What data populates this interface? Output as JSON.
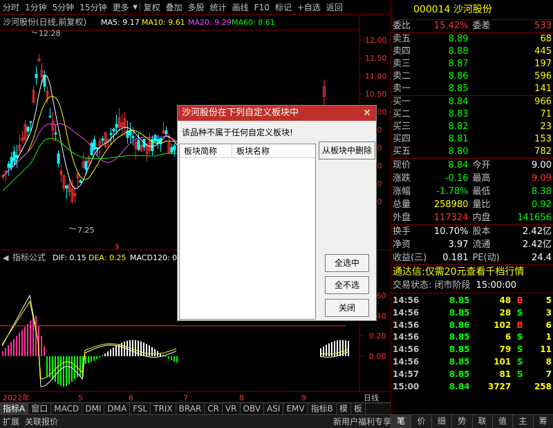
{
  "toolbar": {
    "items": [
      "分时",
      "1分钟",
      "5分钟",
      "15分钟",
      "更多",
      "复权",
      "叠加",
      "多股",
      "统计",
      "画线",
      "F10",
      "标记",
      "+自选",
      "返回"
    ]
  },
  "kline": {
    "title": "沙河股份(日线,前复权)",
    "ma5": "MA5: 9.17",
    "ma10": "MA10: 9.61",
    "ma20": "MA20: 9.29",
    "ma60": "MA60: 8.61",
    "high_label": "12.28",
    "low_label": "7.25",
    "yticks": [
      "12.00",
      "11.50",
      "11.00",
      "10.50",
      "10.00",
      "9.50",
      "9.00",
      "8.50",
      "8.00",
      "7.50"
    ],
    "dollar": "$"
  },
  "macd": {
    "label": "指标公式",
    "dif": "DIF: 0.15",
    "dea": "DEA: 0.25",
    "macd": "MACD120: 0.",
    "yticks": [
      "0.60",
      "0.40",
      "0.20",
      "0.00"
    ]
  },
  "xaxis": {
    "year": "2022年",
    "months": [
      "5",
      "6",
      "7",
      "8",
      "9"
    ],
    "period": "日线"
  },
  "bottombar": {
    "items": [
      "指标A",
      "窗口",
      "MACD",
      "DMI",
      "DMA",
      "FSL",
      "TRIX",
      "BRAR",
      "CR",
      "VR",
      "OBV",
      "ASI",
      "EMV",
      "指标B",
      "模",
      "板"
    ]
  },
  "statusbar": {
    "left1": "扩展",
    "left2": "关联报价",
    "right": "新用户福利专享"
  },
  "quote": {
    "code": "000014",
    "name": "沙河股份",
    "weibi_label": "委比",
    "weibi": "15.42%",
    "weicha_label": "委差",
    "weicha": "533",
    "asks": [
      {
        "label": "卖五",
        "price": "8.89",
        "vol": "68"
      },
      {
        "label": "卖四",
        "price": "8.88",
        "vol": "445"
      },
      {
        "label": "卖三",
        "price": "8.87",
        "vol": "197"
      },
      {
        "label": "卖二",
        "price": "8.86",
        "vol": "596"
      },
      {
        "label": "卖一",
        "price": "8.85",
        "vol": "141"
      }
    ],
    "bids": [
      {
        "label": "买一",
        "price": "8.84",
        "vol": "966"
      },
      {
        "label": "买二",
        "price": "8.83",
        "vol": "71"
      },
      {
        "label": "买三",
        "price": "8.82",
        "vol": "23"
      },
      {
        "label": "买四",
        "price": "8.81",
        "vol": "153"
      },
      {
        "label": "买五",
        "price": "8.80",
        "vol": "782"
      }
    ],
    "stats1": [
      {
        "l1": "现价",
        "v1": "8.84",
        "c1": "#00ff00",
        "l2": "今开",
        "v2": "9.00",
        "c2": "#ffffff"
      },
      {
        "l1": "涨跌",
        "v1": "-0.16",
        "c1": "#00ff00",
        "l2": "最高",
        "v2": "9.09",
        "c2": "#ff3333"
      },
      {
        "l1": "涨幅",
        "v1": "-1.78%",
        "c1": "#00ff00",
        "l2": "最低",
        "v2": "8.38",
        "c2": "#00ff00"
      },
      {
        "l1": "总量",
        "v1": "258980",
        "c1": "#ffff00",
        "l2": "量比",
        "v2": "0.92",
        "c2": "#00ff00"
      },
      {
        "l1": "外盘",
        "v1": "117324",
        "c1": "#ff3333",
        "l2": "内盘",
        "v2": "141656",
        "c2": "#00ff00"
      }
    ],
    "stats2": [
      {
        "l1": "换手",
        "v1": "10.70%",
        "l2": "股本",
        "v2": "2.42亿"
      },
      {
        "l1": "净资",
        "v1": "3.97",
        "l2": "流通",
        "v2": "2.42亿"
      },
      {
        "l1": "收益(三)",
        "v1": "0.181",
        "l2": "PE(动)",
        "v2": "24.4"
      }
    ],
    "ad": "通达信:仅需20元查看千档行情",
    "trade_status": "交易状态: 闭市阶段",
    "trade_time": "15:00:00",
    "ticks": [
      {
        "t": "14:56",
        "p": "8.85",
        "v": "48",
        "f": "B",
        "n": "5"
      },
      {
        "t": "14:56",
        "p": "8.85",
        "v": "28",
        "f": "S",
        "n": "3"
      },
      {
        "t": "14:56",
        "p": "8.86",
        "v": "102",
        "f": "B",
        "n": "6"
      },
      {
        "t": "14:56",
        "p": "8.85",
        "v": "6",
        "f": "S",
        "n": "1"
      },
      {
        "t": "14:56",
        "p": "8.85",
        "v": "79",
        "f": "S",
        "n": "11"
      },
      {
        "t": "14:56",
        "p": "8.85",
        "v": "101",
        "f": "S",
        "n": "8"
      },
      {
        "t": "14:57",
        "p": "8.85",
        "v": "81",
        "f": "S",
        "n": "7"
      },
      {
        "t": "15:00",
        "p": "8.84",
        "v": "3727",
        "f": "",
        "n": "258"
      }
    ],
    "nav": [
      "笔",
      "价",
      "细",
      "势",
      "联",
      "值",
      "主",
      "筹"
    ]
  },
  "dialog": {
    "title": "沙河股份在下列自定义板块中",
    "close": "✕",
    "message": "该品种不属于任何自定义板块!",
    "col1": "板块简称",
    "col2": "板块名称",
    "remove": "从板块中删除",
    "select_all": "全选中",
    "select_none": "全不选",
    "close_btn": "关闭"
  },
  "colors": {
    "up": "#ff3333",
    "down": "#00ff00",
    "accent": "#ffff00",
    "frame": "#800000"
  }
}
